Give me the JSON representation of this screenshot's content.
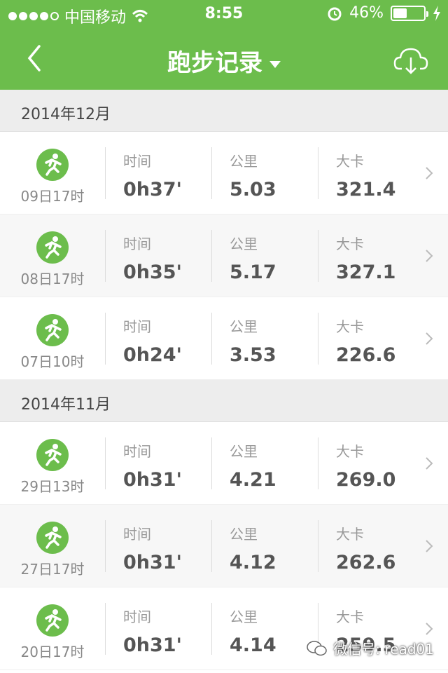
{
  "status_bar": {
    "carrier": "中国移动",
    "time": "8:55",
    "battery_percent": "46%",
    "battery_level": 0.46
  },
  "nav": {
    "title": "跑步记录"
  },
  "labels": {
    "time": "时间",
    "distance": "公里",
    "calories": "大卡"
  },
  "sections": [
    {
      "month": "2014年12月",
      "records": [
        {
          "date": "09日17时",
          "time": "0h37'",
          "distance": "5.03",
          "calories": "321.4"
        },
        {
          "date": "08日17时",
          "time": "0h35'",
          "distance": "5.17",
          "calories": "327.1"
        },
        {
          "date": "07日10时",
          "time": "0h24'",
          "distance": "3.53",
          "calories": "226.6"
        }
      ]
    },
    {
      "month": "2014年11月",
      "records": [
        {
          "date": "29日13时",
          "time": "0h31'",
          "distance": "4.21",
          "calories": "269.0"
        },
        {
          "date": "27日17时",
          "time": "0h31'",
          "distance": "4.12",
          "calories": "262.6"
        },
        {
          "date": "20日17时",
          "time": "0h31'",
          "distance": "4.14",
          "calories": "259.5"
        }
      ]
    }
  ],
  "watermark": "微信号: read01",
  "colors": {
    "brand_green": "#6cbd4c"
  }
}
